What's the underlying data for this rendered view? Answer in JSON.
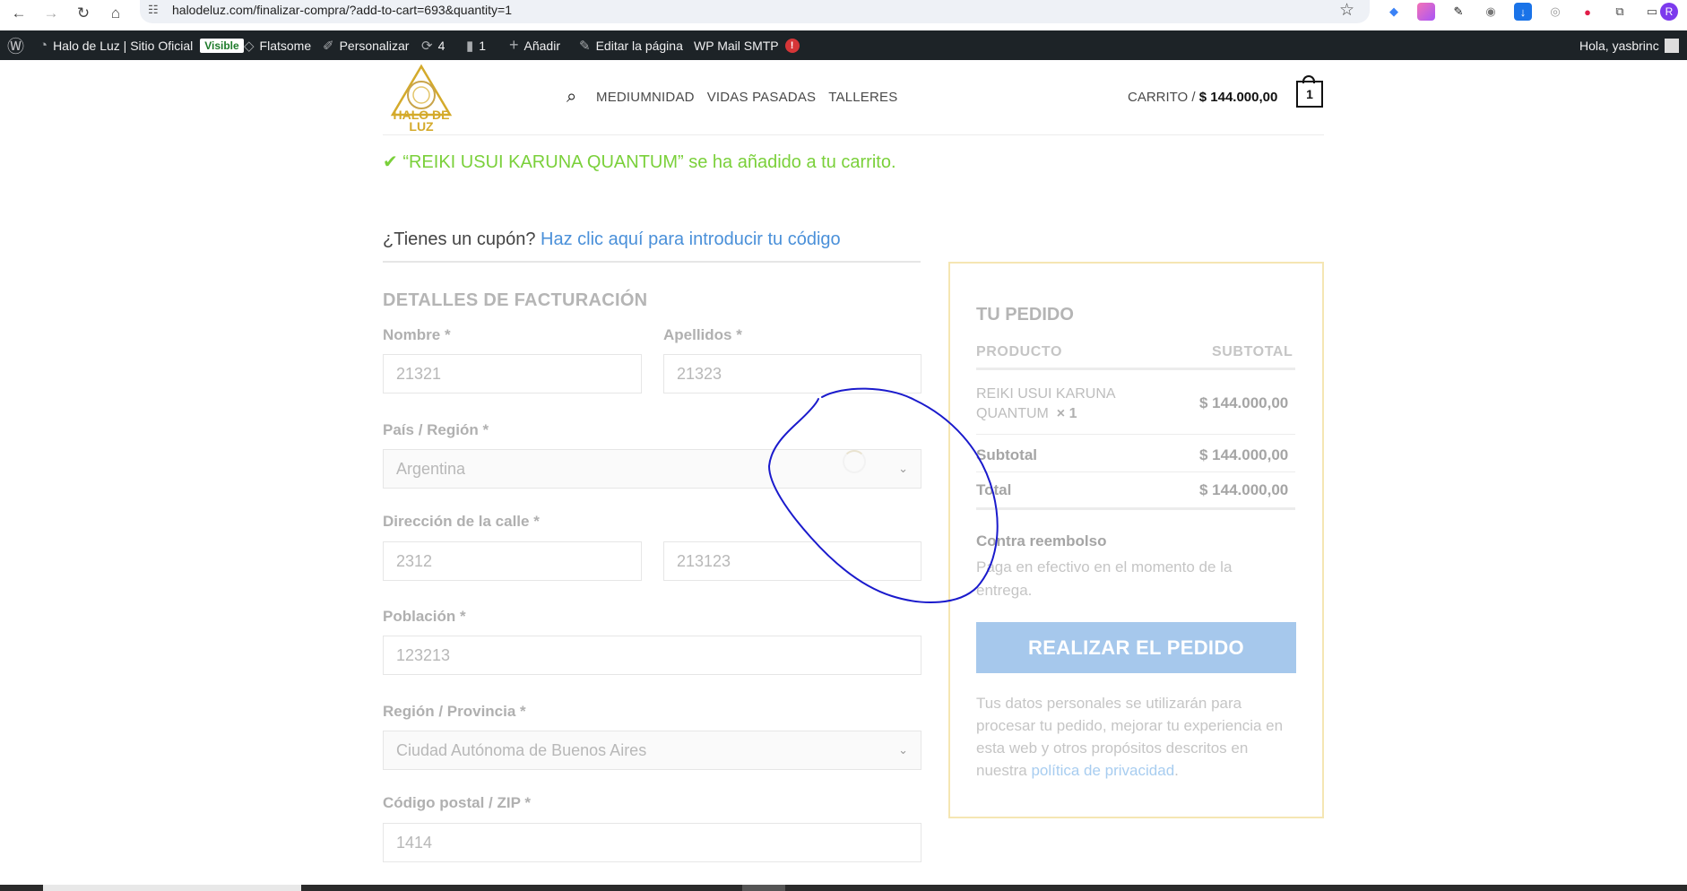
{
  "browser": {
    "url": "halodeluz.com/finalizar-compra/?add-to-cart=693&quantity=1",
    "profile_initial": "R"
  },
  "adminbar": {
    "site_name": "Halo de Luz | Sitio Oficial",
    "visible_badge": "Visible",
    "theme": "Flatsome",
    "customize": "Personalizar",
    "updates_count": "4",
    "comments_count": "1",
    "add_new": "Añadir",
    "edit_page": "Editar la página",
    "smtp": "WP Mail SMTP",
    "smtp_alert": "!",
    "greeting": "Hola, yasbrinc"
  },
  "header": {
    "logo_line1": "HALO DE",
    "logo_line2": "LUZ",
    "nav": [
      "MEDIUMNIDAD",
      "VIDAS PASADAS",
      "TALLERES"
    ],
    "cart_label": "CARRITO /",
    "cart_total": "$ 144.000,00",
    "cart_count": "1"
  },
  "notice": {
    "message": "“REIKI USUI KARUNA QUANTUM” se ha añadido a tu carrito."
  },
  "coupon": {
    "question": "¿Tienes un cupón?",
    "link": "Haz clic aquí para introducir tu código"
  },
  "billing": {
    "title": "DETALLES DE FACTURACIÓN",
    "first_name_label": "Nombre *",
    "first_name_value": "21321",
    "last_name_label": "Apellidos *",
    "last_name_value": "21323",
    "country_label": "País / Región *",
    "country_value": "Argentina",
    "address_label": "Dirección de la calle *",
    "address_1_value": "2312",
    "address_2_value": "213123",
    "city_label": "Población *",
    "city_value": "123213",
    "state_label": "Región / Provincia *",
    "state_value": "Ciudad Autónoma de Buenos Aires",
    "postcode_label": "Código postal / ZIP *",
    "postcode_value": "1414"
  },
  "order": {
    "title": "TU PEDIDO",
    "col_product": "PRODUCTO",
    "col_subtotal": "SUBTOTAL",
    "item_name_line1": "REIKI USUI KARUNA",
    "item_name_line2": "QUANTUM",
    "item_qty": "× 1",
    "item_price": "$ 144.000,00",
    "subtotal_label": "Subtotal",
    "subtotal_value": "$ 144.000,00",
    "total_label": "Total",
    "total_value": "$ 144.000,00",
    "payment_method": "Contra reembolso",
    "payment_desc": "Paga en efectivo en el momento de la entrega.",
    "place_order": "REALIZAR EL PEDIDO",
    "privacy_text": "Tus datos personales se utilizarán para procesar tu pedido, mejorar tu experiencia en esta web y otros propósitos descritos en nuestra",
    "privacy_link": "política de privacidad",
    "privacy_end": "."
  },
  "colors": {
    "success": "#7ad03a",
    "link": "#4a90d9",
    "button": "#a6c8ec",
    "adminbar": "#1d2327",
    "logo_gold": "#d4aa2b",
    "annotation_ink": "#1a1acc"
  }
}
